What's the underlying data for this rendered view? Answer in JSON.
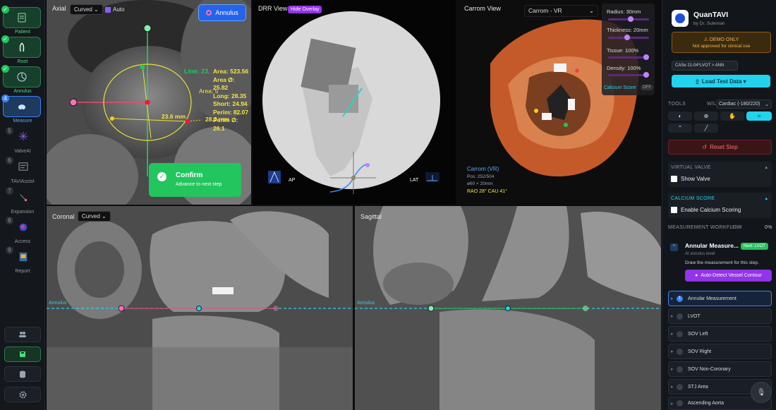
{
  "sidebar": {
    "steps": [
      {
        "label": "Patient",
        "status": "done",
        "icon": "patient-icon"
      },
      {
        "label": "Root",
        "status": "done",
        "icon": "root-icon"
      },
      {
        "label": "Annulus",
        "status": "done",
        "icon": "annulus-icon"
      },
      {
        "label": "Measure",
        "status": "active",
        "num": "4",
        "icon": "measure-icon"
      },
      {
        "label": "ValveAI",
        "status": "pending",
        "num": "5",
        "icon": "valveai-icon"
      },
      {
        "label": "TAVIAssist",
        "status": "pending",
        "num": "6",
        "icon": "taviassist-icon"
      },
      {
        "label": "Expansion",
        "status": "pending",
        "num": "7",
        "icon": "expansion-icon"
      },
      {
        "label": "Access",
        "status": "pending",
        "num": "8",
        "icon": "access-icon"
      },
      {
        "label": "Report",
        "status": "pending",
        "num": "9",
        "icon": "report-icon"
      }
    ],
    "bottom_icons": [
      "users-icon",
      "save-icon",
      "database-icon",
      "settings-icon"
    ]
  },
  "axial": {
    "label": "Axial",
    "mode": "Curved",
    "auto_label": "Auto",
    "annulus_button": "Annulus",
    "measure_lines": [
      "Line: 23.",
      "Area: 523.56",
      "Area Ø: 25.82",
      "Long: 28.35",
      "Short: 24.94",
      "Perim: 82.07",
      "Perim Ø: 26.1"
    ],
    "area_overlay": "Area: 5",
    "short_mm": "23.6 mm",
    "long_mm": "28.3 mm",
    "confirm_title": "Confirm",
    "confirm_sub": "Advance to next step"
  },
  "drr": {
    "label": "DRR View",
    "overlay_button": "Hide Overlay",
    "ap": "AP",
    "lat": "LAT"
  },
  "carrom": {
    "label": "Carrom View",
    "mode": "Carrom - VR",
    "radius": "Radius: 30mm",
    "thickness": "Thickness: 20mm",
    "tissue": "Tissue: 100%",
    "density": "Density: 100%",
    "calcium_score": "Calcium Score",
    "calcium_toggle": "OFF",
    "view_title": "Carrom (VR)",
    "pos": "Pos: 252/504",
    "size": "ø60 × 20mm",
    "angle": "RAO 28° CAU 41°",
    "levels": {
      "radius": 0.55,
      "thickness": 0.45,
      "tissue": 1.0,
      "density": 1.0
    }
  },
  "coronal": {
    "label": "Coronal",
    "mode": "Curved",
    "annulus": "Annulus"
  },
  "sagittal": {
    "label": "Sagittal",
    "annulus": "Annulus"
  },
  "panel": {
    "app_name": "QuanTAVI",
    "by": "by Dr. Suleman",
    "demo_title": "⚠ DEMO ONLY",
    "demo_sub": "Not approved for clinical use",
    "case_chip": "CASe 21-04*LVOT > ANN",
    "load_button": "Load Test Data ▾",
    "tools_label": "TOOLS",
    "wl_label": "W/L",
    "wl_value": "Cardiac (-180/220)",
    "reset_button": "Reset Step",
    "virtual_valve": "VIRTUAL VALVE",
    "show_valve": "Show Valve",
    "calcium_score": "CALCIUM SCORE",
    "enable_calcium": "Enable Calcium Scoring",
    "workflow_label": "MEASUREMENT WORKFLOW",
    "workflow_count": "0/10",
    "workflow_pct": "0%",
    "current_title": "Annular Measure...",
    "current_badge": "Next: LVOT",
    "current_sub": "At annulus level",
    "current_desc": "Draw the measurement for this step.",
    "auto_detect": "Auto-Detect Vessel Contour",
    "workflow_items": [
      "Annular Measurement",
      "LVOT",
      "SOV Left",
      "SOV Right",
      "SOV Non-Coronary",
      "STJ Area",
      "Ascending Aorta"
    ]
  },
  "colors": {
    "accent": "#3b82f6",
    "green": "#22c55e",
    "purple": "#9333ea",
    "cyan": "#22d3ee",
    "yellow": "#f5e642"
  }
}
